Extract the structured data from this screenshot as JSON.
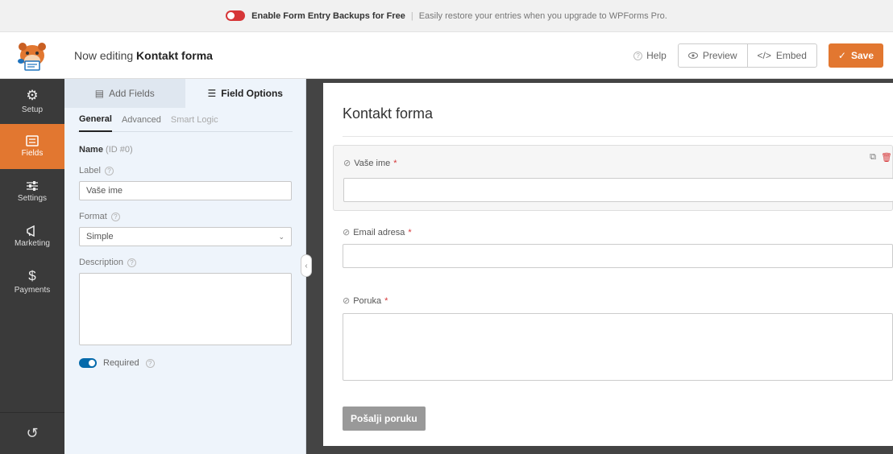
{
  "notice": {
    "title": "Enable Form Entry Backups for Free",
    "text": "Easily restore your entries when you upgrade to WPForms Pro."
  },
  "header": {
    "prefix": "Now editing",
    "form_name": "Kontakt forma",
    "help": "Help",
    "preview": "Preview",
    "embed": "Embed",
    "save": "Save"
  },
  "sidebar": {
    "items": [
      {
        "label": "Setup",
        "icon": "gear-icon"
      },
      {
        "label": "Fields",
        "icon": "fields-icon"
      },
      {
        "label": "Settings",
        "icon": "sliders-icon"
      },
      {
        "label": "Marketing",
        "icon": "megaphone-icon"
      },
      {
        "label": "Payments",
        "icon": "dollar-icon"
      }
    ]
  },
  "panel": {
    "tab_add": "Add Fields",
    "tab_options": "Field Options",
    "subtab_general": "General",
    "subtab_advanced": "Advanced",
    "subtab_logic": "Smart Logic",
    "field_name": "Name",
    "field_id": "(ID #0)",
    "label_label": "Label",
    "label_value": "Vaše ime",
    "format_label": "Format",
    "format_value": "Simple",
    "description_label": "Description",
    "required_label": "Required"
  },
  "preview": {
    "form_title": "Kontakt forma",
    "fields": [
      {
        "label": "Vaše ime",
        "required": "*"
      },
      {
        "label": "Email adresa",
        "required": "*"
      },
      {
        "label": "Poruka",
        "required": "*"
      }
    ],
    "submit": "Pošalji poruku"
  },
  "colors": {
    "accent": "#e27730",
    "sidebar": "#3a3a3a",
    "toggle_on": "#056aab",
    "toggle_off": "#d63638"
  }
}
